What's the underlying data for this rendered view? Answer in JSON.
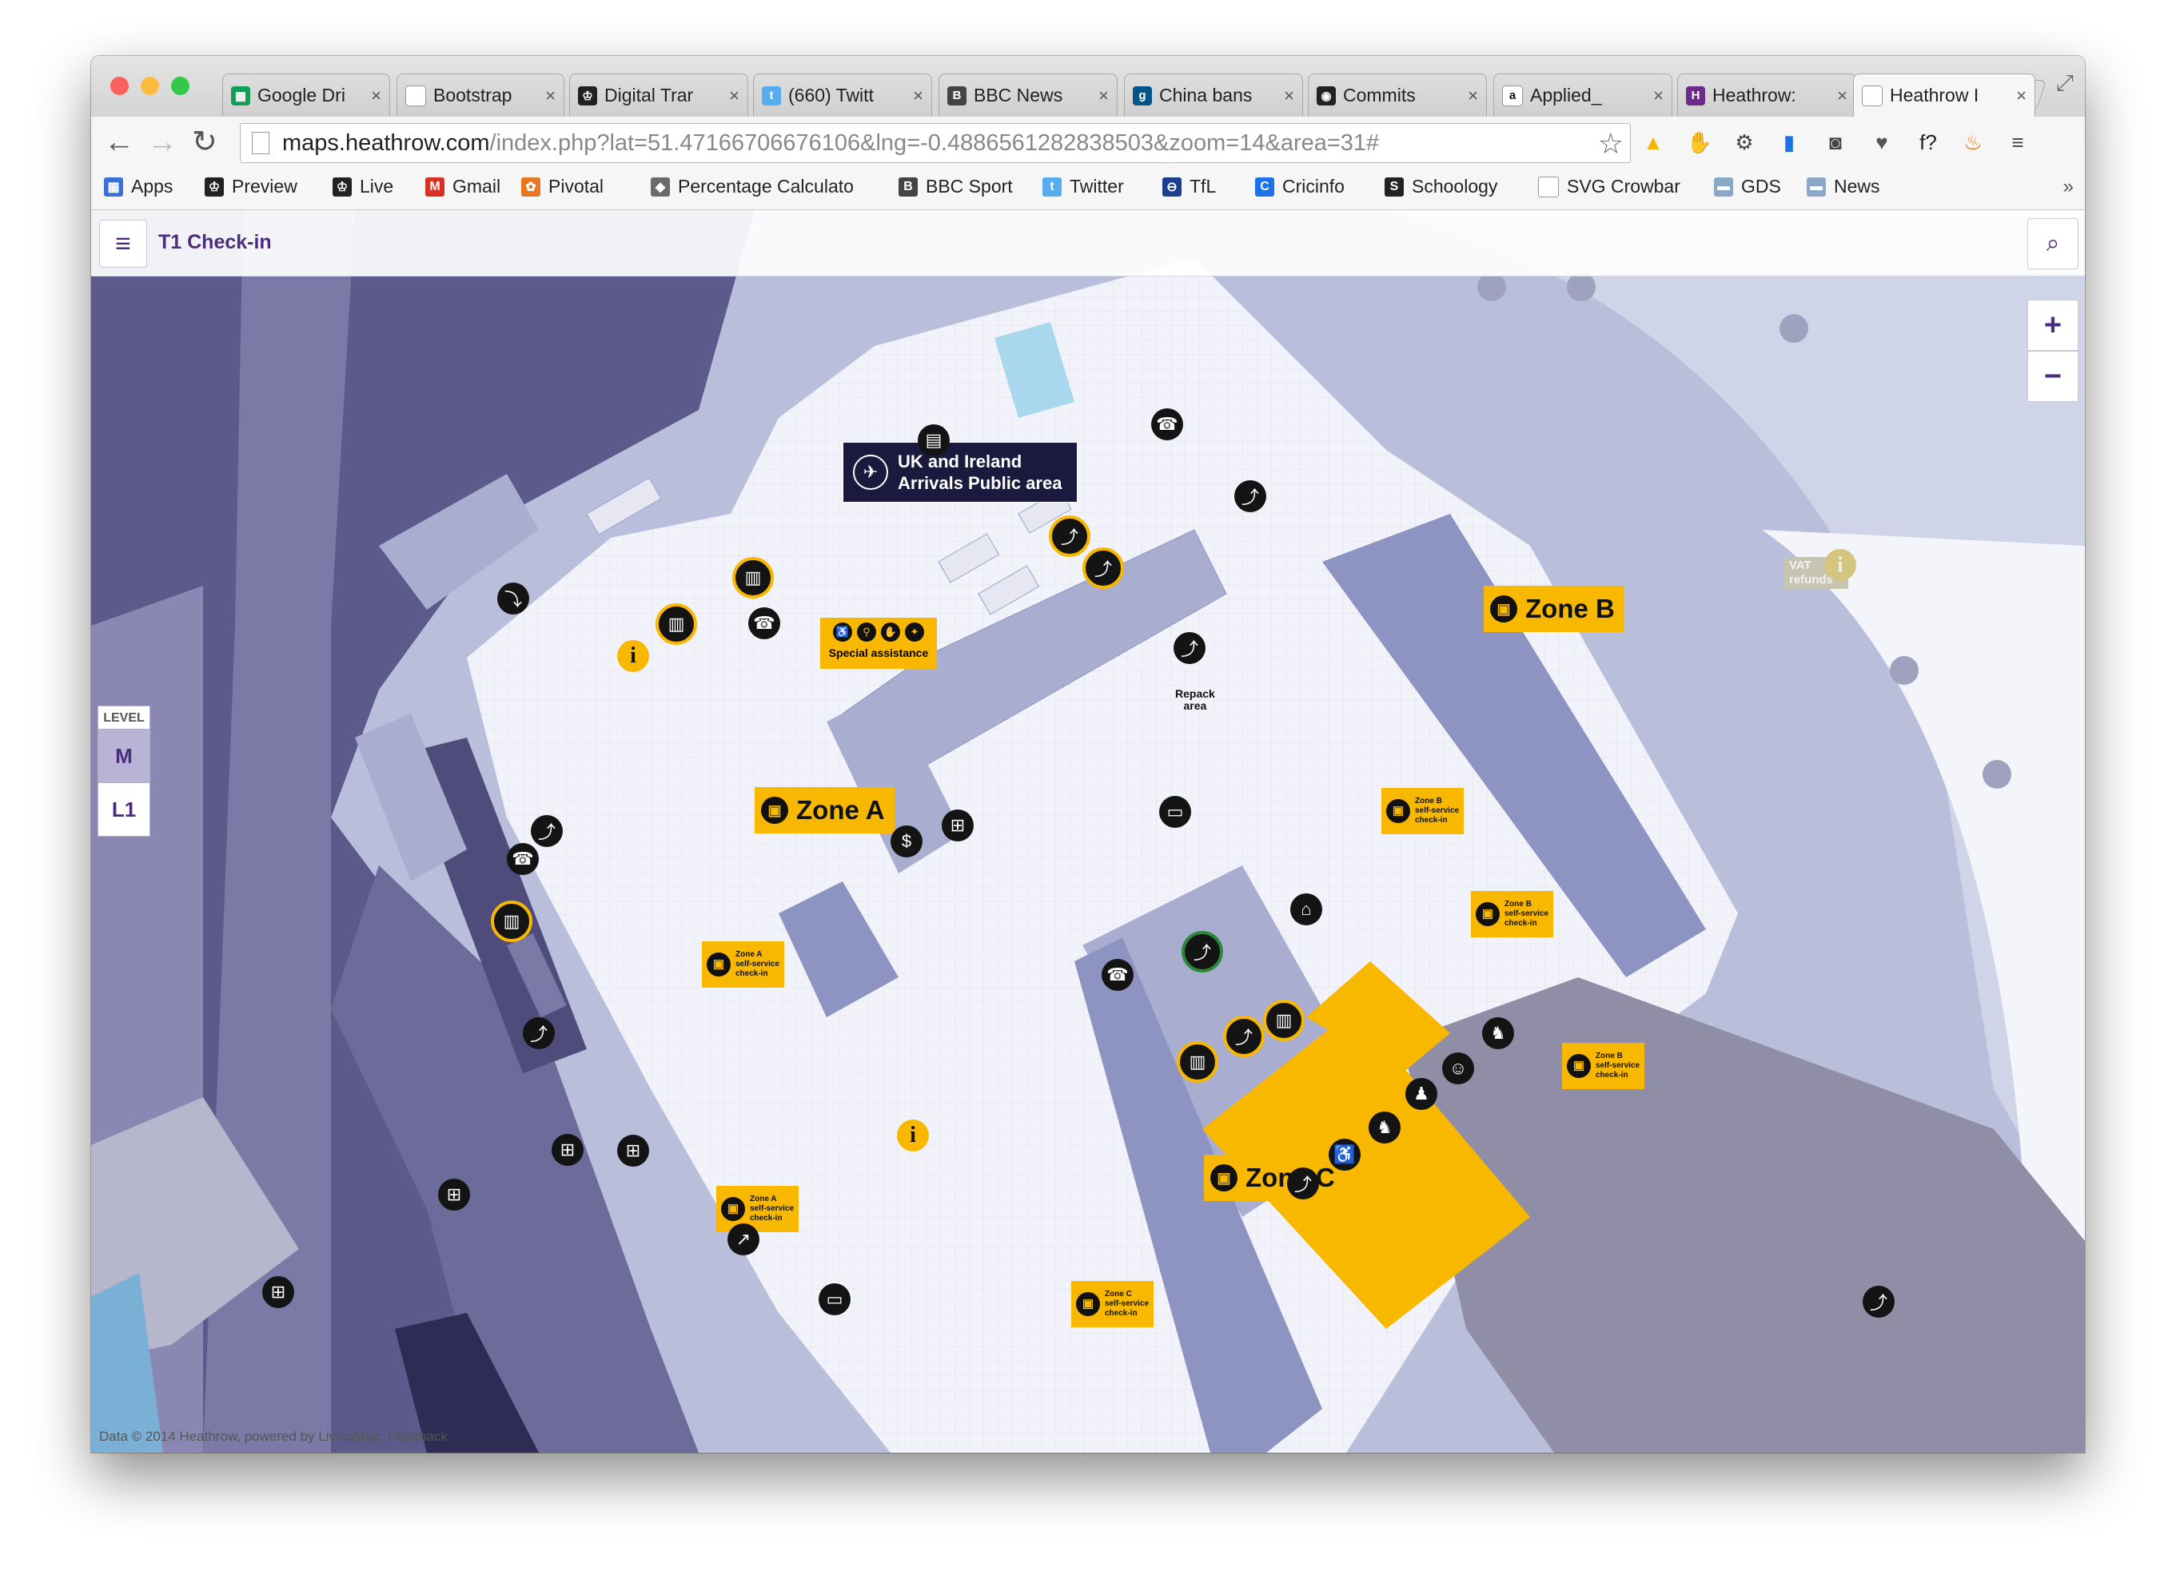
{
  "window": {
    "traffic_lights": [
      "#fc605c",
      "#fdbc40",
      "#34c84a"
    ],
    "tabs": [
      {
        "label": "Google Dri",
        "icon": "sheets-icon",
        "color": "#0f9d58",
        "glyph": "▦"
      },
      {
        "label": "Bootstrap",
        "icon": "page-icon",
        "color": "#ffffff",
        "glyph": ""
      },
      {
        "label": "Digital Trar",
        "icon": "crown-icon",
        "color": "#222222",
        "glyph": "♔"
      },
      {
        "label": "(660) Twitt",
        "icon": "twitter-icon",
        "color": "#55acee",
        "glyph": "t"
      },
      {
        "label": "BBC News",
        "icon": "bbc-icon",
        "color": "#444444",
        "glyph": "B"
      },
      {
        "label": "China bans",
        "icon": "guardian-icon",
        "color": "#005689",
        "glyph": "g"
      },
      {
        "label": "Commits",
        "icon": "github-icon",
        "color": "#222222",
        "glyph": "◉"
      },
      {
        "label": "Applied_",
        "icon": "amazon-icon",
        "color": "#ffffff",
        "glyph": "a"
      },
      {
        "label": "Heathrow:",
        "icon": "heathrow-icon",
        "color": "#6b2a8c",
        "glyph": "H"
      },
      {
        "label": "Heathrow I",
        "icon": "page-icon",
        "color": "#ffffff",
        "glyph": ""
      }
    ],
    "close_glyph": "×",
    "new_tab_label": ""
  },
  "toolbar": {
    "back": "←",
    "forward": "→",
    "reload": "↻",
    "url_host": "maps.heathrow.com",
    "url_rest": "/index.php?lat=51.47166706676106&lng=-0.4886561282838503&zoom=14&area=31#",
    "star": "☆",
    "extensions": [
      {
        "name": "drive-icon",
        "glyph": "▲",
        "color": "#f4b400"
      },
      {
        "name": "stop-hand-icon",
        "glyph": "✋",
        "color": "#d93025"
      },
      {
        "name": "gear-icon",
        "glyph": "⚙",
        "color": "#444444"
      },
      {
        "name": "analytics-icon",
        "glyph": "▮",
        "color": "#1a73e8"
      },
      {
        "name": "camera-icon",
        "glyph": "◙",
        "color": "#444444"
      },
      {
        "name": "pocket-icon",
        "glyph": "♥",
        "color": "#555555"
      },
      {
        "name": "font-icon",
        "glyph": "f?",
        "color": "#222222"
      },
      {
        "name": "flame-icon",
        "glyph": "♨",
        "color": "#e8710a"
      },
      {
        "name": "menu-icon",
        "glyph": "≡",
        "color": "#444444"
      }
    ]
  },
  "bookmarks": [
    {
      "label": "Apps",
      "glyph": "▦",
      "color": "#3b6fd8"
    },
    {
      "label": "Preview",
      "glyph": "♔",
      "color": "#222222"
    },
    {
      "label": "Live",
      "glyph": "♔",
      "color": "#222222"
    },
    {
      "label": "Gmail",
      "glyph": "M",
      "color": "#d93025"
    },
    {
      "label": "Pivotal",
      "glyph": "✿",
      "color": "#e87722"
    },
    {
      "label": "Percentage Calculato",
      "glyph": "◆",
      "color": "#6a6a6a"
    },
    {
      "label": "BBC Sport",
      "glyph": "B",
      "color": "#444444"
    },
    {
      "label": "Twitter",
      "glyph": "t",
      "color": "#55acee"
    },
    {
      "label": "TfL",
      "glyph": "⊖",
      "color": "#1c3f94"
    },
    {
      "label": "Cricinfo",
      "glyph": "C",
      "color": "#1a73e8"
    },
    {
      "label": "Schoology",
      "glyph": "S",
      "color": "#222222"
    },
    {
      "label": "SVG Crowbar",
      "glyph": "",
      "color": "#ffffff"
    },
    {
      "label": "GDS",
      "glyph": "▬",
      "color": "#8aa7c8"
    },
    {
      "label": "News",
      "glyph": "▬",
      "color": "#8aa7c8"
    }
  ],
  "bookmarks_more": "»",
  "app": {
    "menu_glyph": "≡",
    "title": "T1 Check-in",
    "search_glyph": "🔍",
    "zoom_in": "+",
    "zoom_out": "−"
  },
  "levels": {
    "header": "LEVEL",
    "items": [
      {
        "label": "M",
        "selected": true
      },
      {
        "label": "L1",
        "selected": false
      }
    ]
  },
  "map": {
    "arrivals_label_line1": "UK and Ireland",
    "arrivals_label_line2": "Arrivals Public area",
    "special_assistance": "Special assistance",
    "repack_line1": "Repack",
    "repack_line2": "area",
    "vat_line1": "VAT",
    "vat_line2": "refunds",
    "zones": [
      {
        "label": "Zone A"
      },
      {
        "label": "Zone B"
      },
      {
        "label": "Zone C"
      }
    ],
    "self_service": [
      {
        "line1": "Zone A",
        "line2": "self-service",
        "line3": "check-in"
      },
      {
        "line1": "Zone A",
        "line2": "self-service",
        "line3": "check-in"
      },
      {
        "line1": "Zone B",
        "line2": "self-service",
        "line3": "check-in"
      },
      {
        "line1": "Zone B",
        "line2": "self-service",
        "line3": "check-in"
      },
      {
        "line1": "Zone B",
        "line2": "self-service",
        "line3": "check-in"
      },
      {
        "line1": "Zone C",
        "line2": "self-service",
        "line3": "check-in"
      }
    ],
    "colors": {
      "outside": "#b9bfdb",
      "road_dark": "#5c5a8a",
      "road_mid": "#7b79a6",
      "floor": "#f2f3fa",
      "building": "#a9aed0",
      "highlight": "#f9b800",
      "dark_zone": "#8f8ea6"
    },
    "attribution": "Data © 2014 Heathrow, powered by LivingMap. Feedback"
  }
}
